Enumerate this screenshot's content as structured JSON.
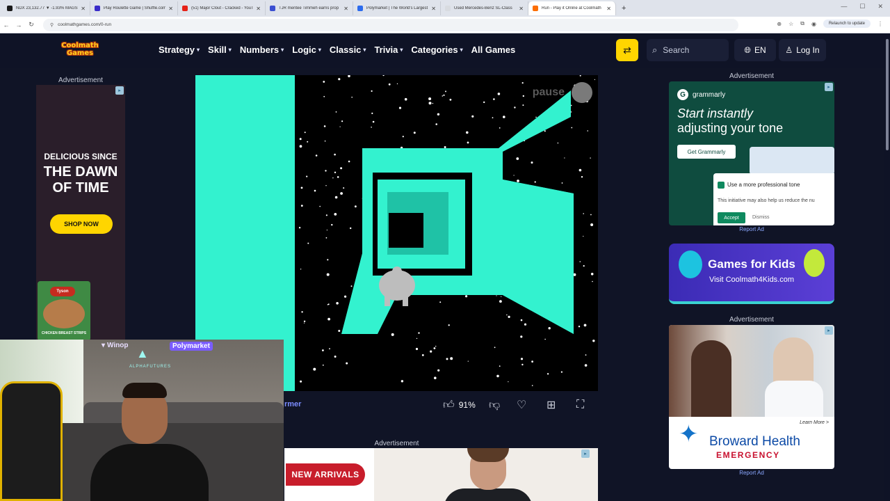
{
  "browser": {
    "tabs": [
      {
        "label": "NDX 23,132.77 ▼ -1.93% MAGS",
        "color": "#1a1a1a"
      },
      {
        "label": "Play Roulette Game | Shuffle.com",
        "color": "#3a2cc9"
      },
      {
        "label": "(51) Major Clout - Cracked - YouTube",
        "color": "#e62117"
      },
      {
        "label": "TJR mentee Timmeh earns prop",
        "color": "#3b4fd1"
      },
      {
        "label": "Polymarket | The World's Largest",
        "color": "#2c6bed"
      },
      {
        "label": "Used Mercedes-Benz SL-Class",
        "color": "#d8dbe0"
      },
      {
        "label": "Run - Play it Online at Coolmath",
        "color": "#fc6e04",
        "active": true
      }
    ],
    "new_tab": "+",
    "url": "coolmathgames.com/0-run",
    "relaunch": "Relaunch to update"
  },
  "header": {
    "logo_line1": "Coolmath",
    "logo_line2": "Games",
    "nav": [
      {
        "label": "Strategy",
        "dropdown": true
      },
      {
        "label": "Skill",
        "dropdown": true
      },
      {
        "label": "Numbers",
        "dropdown": true
      },
      {
        "label": "Logic",
        "dropdown": true
      },
      {
        "label": "Classic",
        "dropdown": true
      },
      {
        "label": "Trivia",
        "dropdown": true
      },
      {
        "label": "Categories",
        "dropdown": true
      },
      {
        "label": "All Games",
        "dropdown": false
      }
    ],
    "search_placeholder": "Search",
    "language": "EN",
    "login": "Log In"
  },
  "left_ad": {
    "label": "Advertisement",
    "line1": "DELICIOUS SINCE",
    "line2": "THE DAWN OF TIME",
    "cta": "SHOP NOW",
    "brand": "Tyson",
    "product": "CHICKEN BREAST STRIPS"
  },
  "game": {
    "pause_label": "pause",
    "genre_link": "rmer",
    "rating": "91%",
    "colors": {
      "tunnel": "#33f2cf",
      "space": "#000000"
    }
  },
  "bottom_ad": {
    "label": "Advertisement",
    "cta": "NEW ARRIVALS"
  },
  "right_ads": {
    "label_top": "Advertisement",
    "grammarly": {
      "brand": "grammarly",
      "headline_italic": "Start instantly",
      "headline_rest": "adjusting your tone",
      "button": "Get Grammarly",
      "suggestion": "Use a more professional tone",
      "body": "This initiative may also help us reduce the nu",
      "accept": "Accept",
      "dismiss": "Dismiss"
    },
    "report_ad": "Report Ad",
    "kids": {
      "title": "Games for Kids",
      "subtitle": "Visit Coolmath4Kids.com"
    },
    "label_mid": "Advertisement",
    "broward": {
      "learn_more": "Learn More >",
      "name": "Broward Health",
      "department": "EMERGENCY"
    },
    "report_ad_2": "Report Ad"
  },
  "webcam": {
    "sponsor1": "Winop",
    "sponsor2": "Polymarket",
    "overlay_text": "ALPHAFUTURES"
  }
}
